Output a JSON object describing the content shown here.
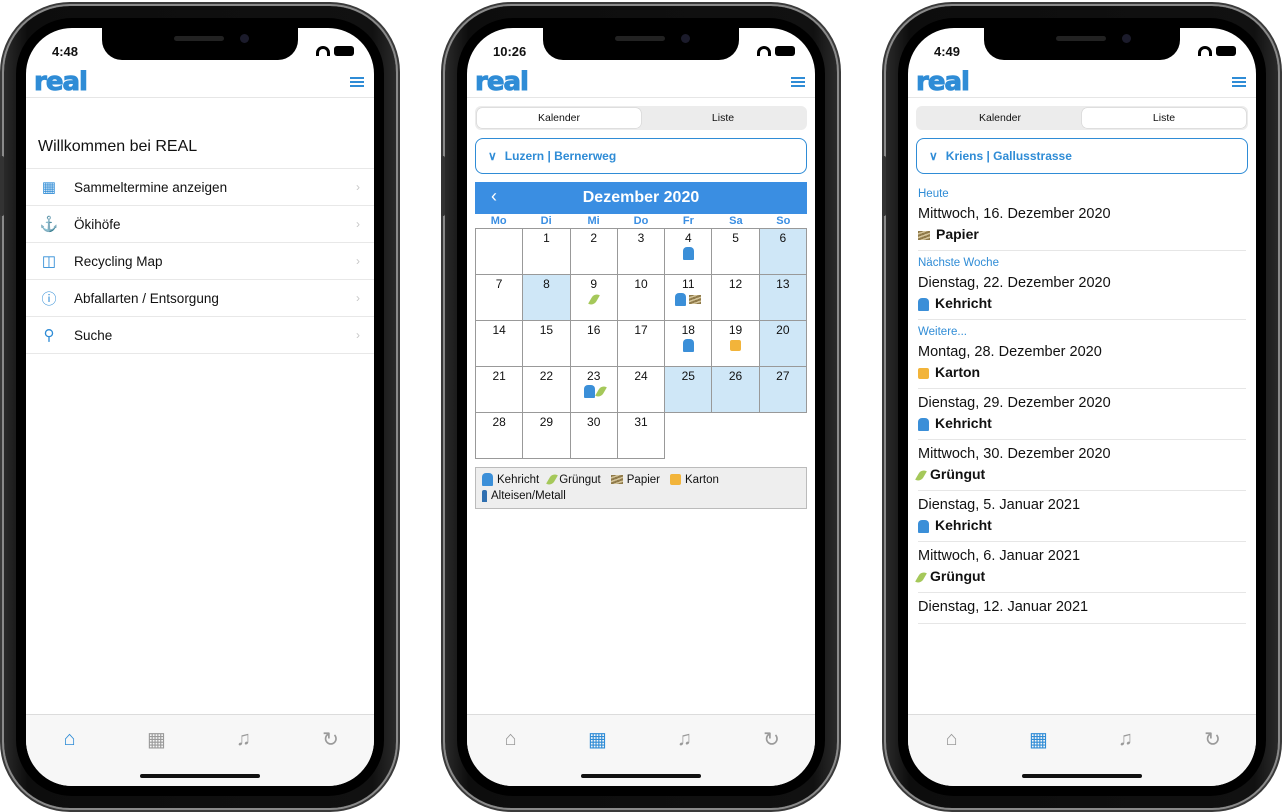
{
  "brand": {
    "logo_text": "real",
    "accent": "#2f8cd6",
    "calendar_header_color": "#3a8ee2",
    "weekend_color": "#cfe7f7"
  },
  "tabbar_icons": [
    "home-icon",
    "calendar-icon",
    "bell-icon",
    "refresh-icon"
  ],
  "phone1": {
    "time": "4:48",
    "welcome": "Willkommen bei REAL",
    "menu": [
      {
        "icon": "calendar-icon",
        "label": "Sammeltermine anzeigen"
      },
      {
        "icon": "location-icon",
        "label": "Ökihöfe"
      },
      {
        "icon": "map-icon",
        "label": "Recycling Map"
      },
      {
        "icon": "info-icon",
        "label": "Abfallarten / Entsorgung"
      },
      {
        "icon": "search-icon",
        "label": "Suche"
      }
    ],
    "active_tab": 0
  },
  "phone2": {
    "time": "10:26",
    "segment": {
      "calendar": "Kalender",
      "list": "Liste",
      "selected": "Kalender"
    },
    "location": "Luzern | Bernerweg",
    "month": "Dezember 2020",
    "weekdays": [
      "Mo",
      "Di",
      "Mi",
      "Do",
      "Fr",
      "Sa",
      "So"
    ],
    "days": [
      {
        "day": "",
        "markers": [],
        "weekend": false
      },
      {
        "day": "1",
        "markers": [],
        "weekend": false
      },
      {
        "day": "2",
        "markers": [],
        "weekend": false
      },
      {
        "day": "3",
        "markers": [],
        "weekend": false
      },
      {
        "day": "4",
        "markers": [
          "kehricht"
        ],
        "weekend": false
      },
      {
        "day": "5",
        "markers": [],
        "weekend": false
      },
      {
        "day": "6",
        "markers": [],
        "weekend": true
      },
      {
        "day": "7",
        "markers": [],
        "weekend": false
      },
      {
        "day": "8",
        "markers": [],
        "weekend": true
      },
      {
        "day": "9",
        "markers": [
          "gruen"
        ],
        "weekend": false
      },
      {
        "day": "10",
        "markers": [],
        "weekend": false
      },
      {
        "day": "11",
        "markers": [
          "kehricht",
          "papier"
        ],
        "weekend": false
      },
      {
        "day": "12",
        "markers": [],
        "weekend": false
      },
      {
        "day": "13",
        "markers": [],
        "weekend": true
      },
      {
        "day": "14",
        "markers": [],
        "weekend": false
      },
      {
        "day": "15",
        "markers": [],
        "weekend": false
      },
      {
        "day": "16",
        "markers": [],
        "weekend": false
      },
      {
        "day": "17",
        "markers": [],
        "weekend": false
      },
      {
        "day": "18",
        "markers": [
          "kehricht"
        ],
        "weekend": false
      },
      {
        "day": "19",
        "markers": [
          "karton"
        ],
        "weekend": false
      },
      {
        "day": "20",
        "markers": [],
        "weekend": true
      },
      {
        "day": "21",
        "markers": [],
        "weekend": false
      },
      {
        "day": "22",
        "markers": [],
        "weekend": false
      },
      {
        "day": "23",
        "markers": [
          "kehricht",
          "gruen"
        ],
        "weekend": false
      },
      {
        "day": "24",
        "markers": [],
        "weekend": false
      },
      {
        "day": "25",
        "markers": [],
        "weekend": true
      },
      {
        "day": "26",
        "markers": [],
        "weekend": true
      },
      {
        "day": "27",
        "markers": [],
        "weekend": true
      },
      {
        "day": "28",
        "markers": [],
        "weekend": false
      },
      {
        "day": "29",
        "markers": [],
        "weekend": false
      },
      {
        "day": "30",
        "markers": [],
        "weekend": false
      },
      {
        "day": "31",
        "markers": [],
        "weekend": false
      }
    ],
    "legend": [
      {
        "marker": "kehricht",
        "label": "Kehricht"
      },
      {
        "marker": "gruen",
        "label": "Grüngut"
      },
      {
        "marker": "papier",
        "label": "Papier"
      },
      {
        "marker": "karton",
        "label": "Karton"
      },
      {
        "marker": "metall",
        "label": "Alteisen/Metall"
      }
    ],
    "active_tab": 1
  },
  "phone3": {
    "time": "4:49",
    "segment": {
      "calendar": "Kalender",
      "list": "Liste",
      "selected": "Liste"
    },
    "location": "Kriens | Gallusstrasse",
    "entries": [
      {
        "section": "Heute",
        "date": "Mittwoch, 16. Dezember 2020",
        "marker": "papier",
        "kind": "Papier"
      },
      {
        "section": "Nächste Woche",
        "date": "Dienstag, 22. Dezember 2020",
        "marker": "kehricht",
        "kind": "Kehricht"
      },
      {
        "section": "Weitere...",
        "date": "Montag, 28. Dezember 2020",
        "marker": "karton",
        "kind": "Karton"
      },
      {
        "section": "",
        "date": "Dienstag, 29. Dezember 2020",
        "marker": "kehricht",
        "kind": "Kehricht"
      },
      {
        "section": "",
        "date": "Mittwoch, 30. Dezember 2020",
        "marker": "gruen",
        "kind": "Grüngut"
      },
      {
        "section": "",
        "date": "Dienstag, 5. Januar 2021",
        "marker": "kehricht",
        "kind": "Kehricht"
      },
      {
        "section": "",
        "date": "Mittwoch, 6. Januar 2021",
        "marker": "gruen",
        "kind": "Grüngut"
      },
      {
        "section": "",
        "date": "Dienstag, 12. Januar 2021",
        "marker": "",
        "kind": ""
      }
    ],
    "active_tab": 1
  }
}
